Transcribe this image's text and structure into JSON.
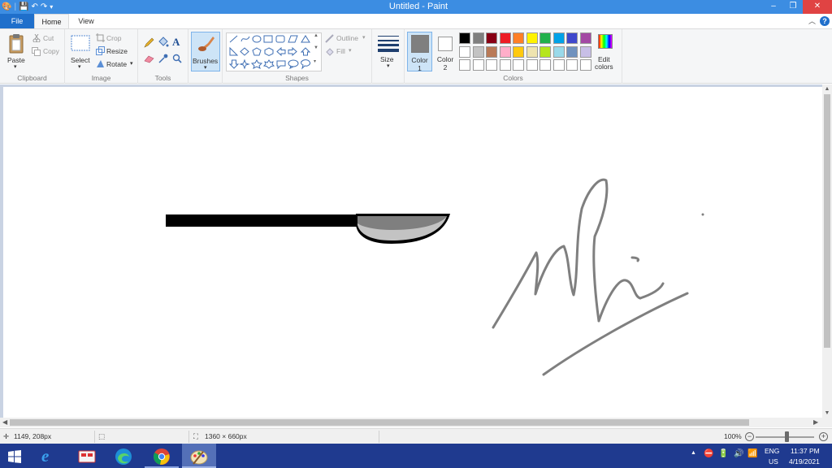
{
  "window": {
    "title": "Untitled - Paint"
  },
  "tabs": [
    {
      "label": "File"
    },
    {
      "label": "Home"
    },
    {
      "label": "View"
    }
  ],
  "ribbon": {
    "clipboard": {
      "label": "Clipboard",
      "paste": "Paste",
      "cut": "Cut",
      "copy": "Copy"
    },
    "image": {
      "label": "Image",
      "select": "Select",
      "crop": "Crop",
      "resize": "Resize",
      "rotate": "Rotate"
    },
    "tools": {
      "label": "Tools"
    },
    "brushes": {
      "label": "Brushes"
    },
    "shapes": {
      "label": "Shapes",
      "outline": "Outline",
      "fill": "Fill"
    },
    "size": {
      "label": "Size"
    },
    "color1": {
      "label": "Color",
      "num": "1",
      "value": "#7f7f7f"
    },
    "color2": {
      "label": "Color",
      "num": "2",
      "value": "#ffffff"
    },
    "colors": {
      "label": "Colors",
      "edit": "Edit",
      "edit2": "colors"
    },
    "palette_row1": [
      "#000000",
      "#7f7f7f",
      "#880015",
      "#ed1c24",
      "#ff7f27",
      "#fff200",
      "#22b14c",
      "#00a2e8",
      "#3f48cc",
      "#a349a4"
    ],
    "palette_row2": [
      "#ffffff",
      "#c3c3c3",
      "#b97a57",
      "#ffaec9",
      "#ffc90e",
      "#efe4b0",
      "#b5e61d",
      "#99d9ea",
      "#7092be",
      "#c8bfe7"
    ],
    "palette_row3": [
      "#ffffff",
      "#ffffff",
      "#ffffff",
      "#ffffff",
      "#ffffff",
      "#ffffff",
      "#ffffff",
      "#ffffff",
      "#ffffff",
      "#ffffff"
    ]
  },
  "status": {
    "cursor": "1149, 208px",
    "canvas_size": "1360 × 660px",
    "zoom": "100%"
  },
  "taskbar": {
    "lang1": "ENG",
    "lang2": "US",
    "time": "11:37 PM",
    "date": "4/19/2021"
  }
}
